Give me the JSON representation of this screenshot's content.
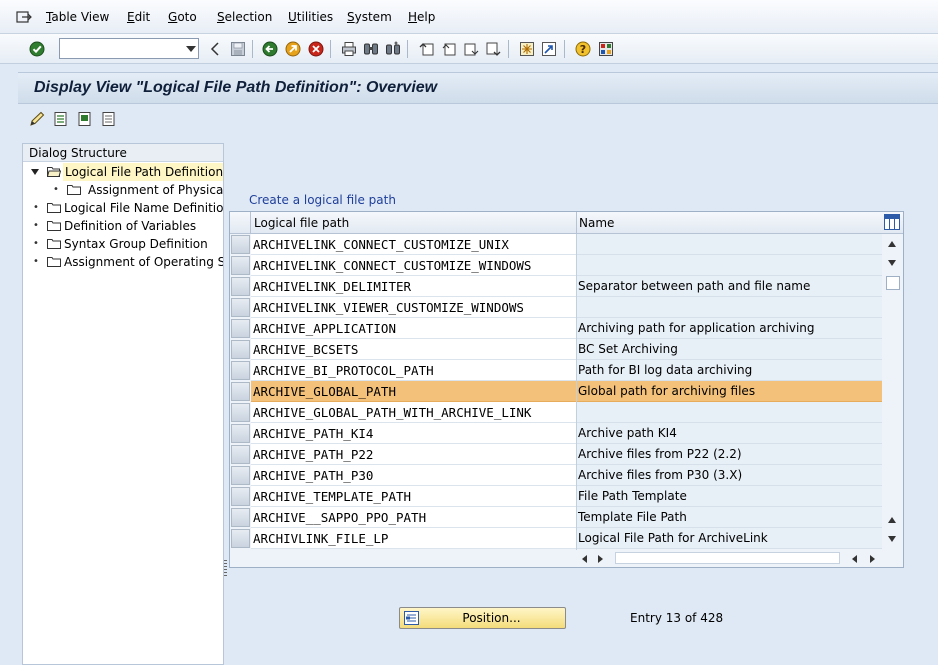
{
  "menu": {
    "items": [
      {
        "underline": "T",
        "rest": "able View"
      },
      {
        "underline": "E",
        "rest": "dit"
      },
      {
        "underline": "G",
        "rest": "oto"
      },
      {
        "underline": "S",
        "rest": "election"
      },
      {
        "underline": "U",
        "rest": "tilities"
      },
      {
        "underline": "S",
        "rest": "ystem"
      },
      {
        "underline": "H",
        "rest": "elp"
      }
    ]
  },
  "toolbar": {
    "command_field_value": ""
  },
  "title": "Display View \"Logical File Path Definition\": Overview",
  "tree": {
    "header": "Dialog Structure",
    "items": [
      {
        "label": "Logical File Path Definition",
        "selected": true,
        "expanded": true,
        "level": 0
      },
      {
        "label": "Assignment of Physical Paths to Logical Path",
        "selected": false,
        "level": 1
      },
      {
        "label": "Logical File Name Definition, Cross-Client",
        "selected": false,
        "level": 0
      },
      {
        "label": "Definition of Variables",
        "selected": false,
        "level": 0
      },
      {
        "label": "Syntax Group Definition",
        "selected": false,
        "level": 0
      },
      {
        "label": "Assignment of Operating System to Syntax Group",
        "selected": false,
        "level": 0
      }
    ]
  },
  "grid": {
    "caption": "Create a logical file path",
    "columns": [
      "Logical file path",
      "Name"
    ],
    "rows": [
      {
        "path": "ARCHIVELINK_CONNECT_CUSTOMIZE_UNIX",
        "name": ""
      },
      {
        "path": "ARCHIVELINK_CONNECT_CUSTOMIZE_WINDOWS",
        "name": ""
      },
      {
        "path": "ARCHIVELINK_DELIMITER",
        "name": "Separator between path and file name"
      },
      {
        "path": "ARCHIVELINK_VIEWER_CUSTOMIZE_WINDOWS",
        "name": ""
      },
      {
        "path": "ARCHIVE_APPLICATION",
        "name": "Archiving path for application archiving"
      },
      {
        "path": "ARCHIVE_BCSETS",
        "name": "BC Set Archiving"
      },
      {
        "path": "ARCHIVE_BI_PROTOCOL_PATH",
        "name": "Path for BI log data archiving"
      },
      {
        "path": "ARCHIVE_GLOBAL_PATH",
        "name": "Global path for archiving files"
      },
      {
        "path": "ARCHIVE_GLOBAL_PATH_WITH_ARCHIVE_LINK",
        "name": ""
      },
      {
        "path": "ARCHIVE_PATH_KI4",
        "name": "Archive path KI4"
      },
      {
        "path": "ARCHIVE_PATH_P22",
        "name": "Archive files from P22 (2.2)"
      },
      {
        "path": "ARCHIVE_PATH_P30",
        "name": "Archive files from P30 (3.X)"
      },
      {
        "path": "ARCHIVE_TEMPLATE_PATH",
        "name": "File Path Template"
      },
      {
        "path": "ARCHIVE__SAPPO_PPO_PATH",
        "name": "Template File Path"
      },
      {
        "path": "ARCHIVLINK_FILE_LP",
        "name": "Logical File Path for ArchiveLink"
      }
    ],
    "highlighted_row": 7
  },
  "footer": {
    "position_label": "Position...",
    "entry_text": "Entry 13 of 428"
  },
  "colors": {
    "highlight": "#f3c17a",
    "tree_selected": "#fef6c5",
    "title_text": "#10203a",
    "caption_link": "#1f3f9a"
  }
}
